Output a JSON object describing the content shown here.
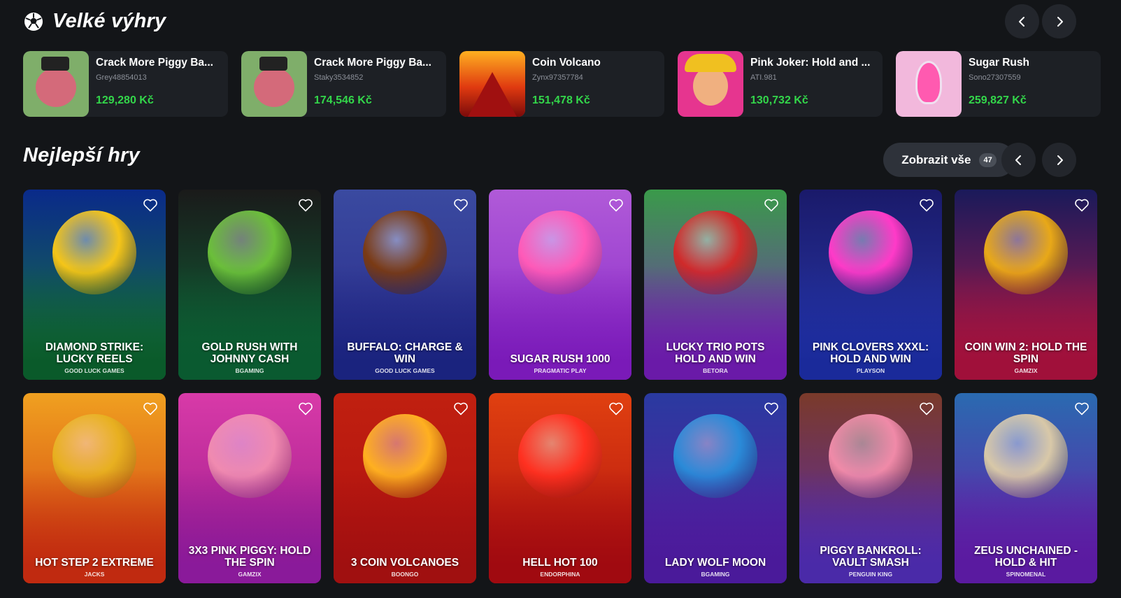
{
  "big_wins": {
    "title": "Velké výhry",
    "icon": "soccer-ball-icon",
    "items": [
      {
        "game": "Crack More Piggy Ba...",
        "user": "Grey48854013",
        "amount": "129,280 Kč",
        "thumb": "piggy",
        "bg": "#7fae6a"
      },
      {
        "game": "Crack More Piggy Ba...",
        "user": "Staky3534852",
        "amount": "174,546 Kč",
        "thumb": "piggy",
        "bg": "#7fae6a"
      },
      {
        "game": "Coin Volcano",
        "user": "Zynx97357784",
        "amount": "151,478 Kč",
        "thumb": "volcano",
        "bg": "#e0421a"
      },
      {
        "game": "Pink Joker: Hold and ...",
        "user": "ATI.981",
        "amount": "130,732 Kč",
        "thumb": "joker",
        "bg": "#e6358f"
      },
      {
        "game": "Sugar Rush",
        "user": "Sono27307559",
        "amount": "259,827 Kč",
        "thumb": "sugar",
        "bg": "#f2b8dc"
      }
    ]
  },
  "best_games": {
    "title": "Nejlepší hry",
    "view_all_label": "Zobrazit vše",
    "view_all_count": "47",
    "games": [
      {
        "title": "Diamond Strike: Lucky Reels",
        "provider": "Good Luck Games",
        "bg1": "#0a2a8a",
        "bg2": "#1a7a3a",
        "accent": "#f5c518",
        "fade": "#0a5a2a"
      },
      {
        "title": "Gold Rush with Johnny Cash",
        "provider": "BGaming",
        "bg1": "#1a1a1a",
        "bg2": "#0e6a3a",
        "accent": "#6bbf3a",
        "fade": "#0a5a30"
      },
      {
        "title": "Buffalo: Charge & Win",
        "provider": "Good Luck Games",
        "bg1": "#3a4aa0",
        "bg2": "#2a2a8a",
        "accent": "#7a3a14",
        "fade": "#1a237e"
      },
      {
        "title": "Sugar Rush 1000",
        "provider": "Pragmatic Play",
        "bg1": "#b05ad8",
        "bg2": "#8a2ac8",
        "accent": "#ff5ab8",
        "fade": "#7a1ab8"
      },
      {
        "title": "Lucky Trio Pots Hold and Win",
        "provider": "Betora",
        "bg1": "#3a9a4a",
        "bg2": "#7a2ab8",
        "accent": "#d02a2a",
        "fade": "#6a1aa8"
      },
      {
        "title": "Pink Clovers XXXL: Hold and Win",
        "provider": "Playson",
        "bg1": "#1a1a6a",
        "bg2": "#2a3ab0",
        "accent": "#ff3ac8",
        "fade": "#1a2a9a"
      },
      {
        "title": "Coin Win 2: Hold the Spin",
        "provider": "Gamzix",
        "bg1": "#1a1a5a",
        "bg2": "#b01a4a",
        "accent": "#e8a818",
        "fade": "#a0103a"
      },
      {
        "title": "Hot Step 2 Extreme",
        "provider": "Jacks",
        "bg1": "#f0a020",
        "bg2": "#d03a10",
        "accent": "#e8b020",
        "fade": "#c02a10"
      },
      {
        "title": "3x3 Pink Piggy: Hold the Spin",
        "provider": "Gamzix",
        "bg1": "#d83aa8",
        "bg2": "#9a1a8a",
        "accent": "#f08ab0",
        "fade": "#8a1a9a"
      },
      {
        "title": "3 Coin Volcanoes",
        "provider": "Boongo",
        "bg1": "#c02010",
        "bg2": "#b01010",
        "accent": "#ffb020",
        "fade": "#a01010"
      },
      {
        "title": "Hell Hot 100",
        "provider": "Endorphina",
        "bg1": "#e04010",
        "bg2": "#b01010",
        "accent": "#ff3020",
        "fade": "#a00a10"
      },
      {
        "title": "Lady Wolf Moon",
        "provider": "BGaming",
        "bg1": "#2a3aa0",
        "bg2": "#5a1aa0",
        "accent": "#2a8ad8",
        "fade": "#4a1a9a"
      },
      {
        "title": "Piggy Bankroll: Vault Smash",
        "provider": "Penguin King",
        "bg1": "#7a3a2a",
        "bg2": "#5a2ab0",
        "accent": "#f08aa8",
        "fade": "#4a2aa8"
      },
      {
        "title": "Zeus Unchained - Hold & Hit",
        "provider": "Spinomenal",
        "bg1": "#2a6ab0",
        "bg2": "#6a1aa8",
        "accent": "#d8c8a8",
        "fade": "#5a1aa0"
      }
    ]
  }
}
